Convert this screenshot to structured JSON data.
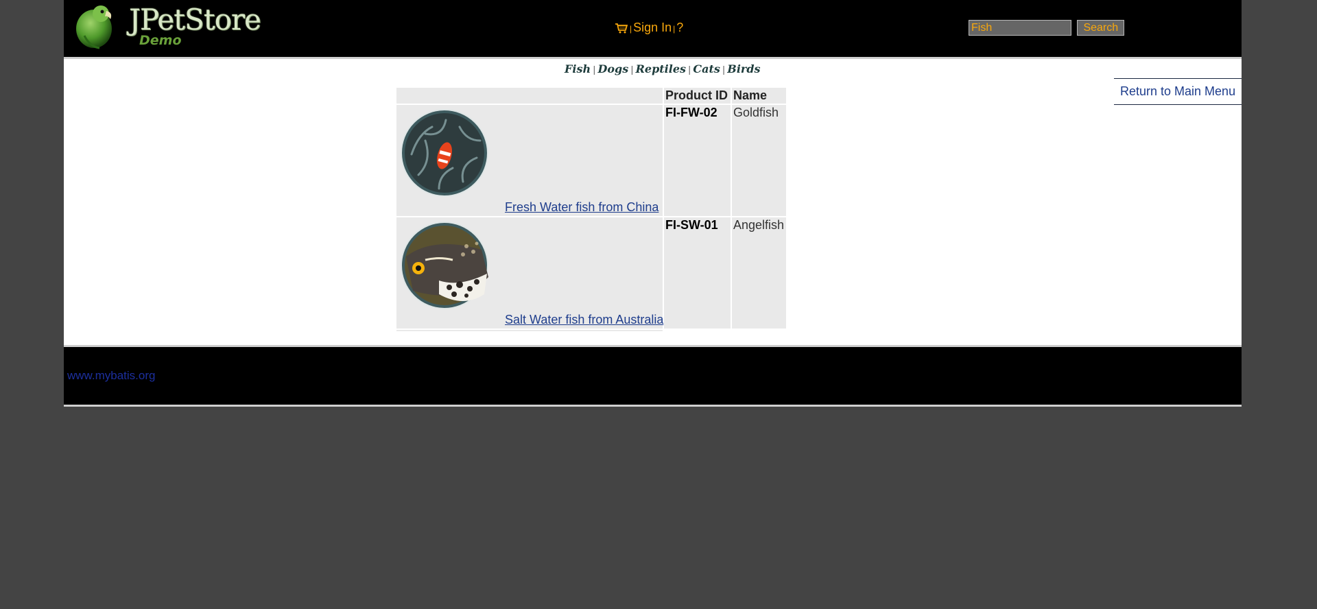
{
  "header": {
    "logo_title": "JPetStore",
    "logo_subtitle": "Demo",
    "menu": {
      "sign_in": "Sign In",
      "help": "?",
      "separator": "|"
    },
    "search": {
      "value": "Fish",
      "button_label": "Search"
    }
  },
  "quicklinks": [
    "Fish",
    "Dogs",
    "Reptiles",
    "Cats",
    "Birds"
  ],
  "back_link": "Return to Main Menu",
  "table": {
    "headers": [
      "",
      "Product ID",
      "Name"
    ],
    "rows": [
      {
        "description": "Fresh Water fish from China",
        "product_id": "FI-FW-02",
        "name": "Goldfish",
        "image_icon": "clownfish-image"
      },
      {
        "description": "Salt Water fish from Australia",
        "product_id": "FI-SW-01",
        "name": "Angelfish",
        "image_icon": "triggerfish-image"
      }
    ]
  },
  "footer": {
    "link": "www.mybatis.org"
  },
  "colors": {
    "accent_orange": "#f9a80c",
    "link_blue": "#1e3d8c",
    "header_bg": "#000000",
    "page_bg": "#444444",
    "table_cell": "#e9e9e9"
  }
}
